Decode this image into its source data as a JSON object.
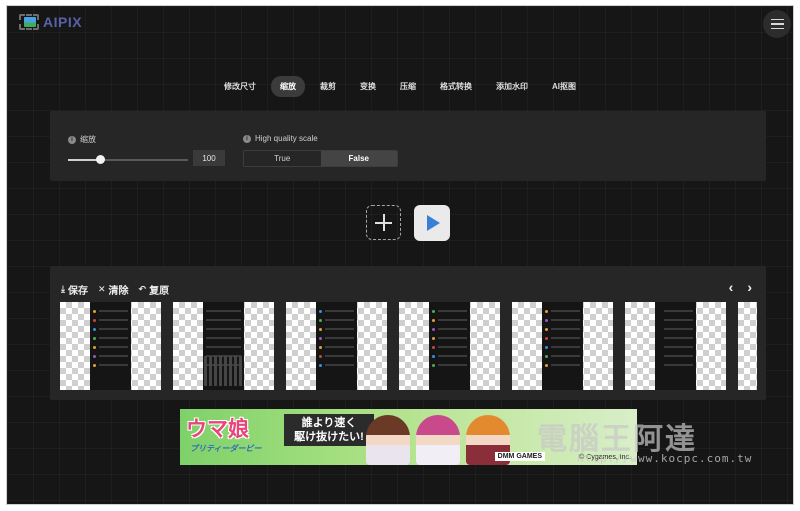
{
  "app": {
    "name": "AIPIX",
    "logo_icon": "image-icon",
    "menu_icon": "hamburger-icon"
  },
  "tabs": [
    {
      "label": "修改尺寸",
      "active": false
    },
    {
      "label": "缩放",
      "active": true
    },
    {
      "label": "裁剪",
      "active": false
    },
    {
      "label": "变换",
      "active": false
    },
    {
      "label": "压缩",
      "active": false
    },
    {
      "label": "格式转换",
      "active": false
    },
    {
      "label": "添加水印",
      "active": false
    },
    {
      "label": "AI抠图",
      "active": false
    }
  ],
  "settings": {
    "scale_label": "缩放",
    "scale_value": "100",
    "slider_fraction": 0.27,
    "hq_label": "High quality scale",
    "hq_options": [
      "True",
      "False"
    ],
    "hq_selected": "False"
  },
  "gallery": {
    "actions": [
      {
        "icon": "download-icon",
        "label": "保存"
      },
      {
        "icon": "close-icon",
        "label": "清除"
      },
      {
        "icon": "undo-icon",
        "label": "复原"
      }
    ],
    "prev_icon": "chevron-left-icon",
    "next_icon": "chevron-right-icon",
    "thumb_count": 7
  },
  "ad": {
    "title": "ウマ娘",
    "subtitle": "プリティーダービー",
    "slogan_line1": "誰より速く",
    "slogan_line2": "駆け抜けたい!",
    "brand": "DMM GAMES",
    "copyright": "© Cygames, Inc."
  },
  "watermark": {
    "text": "電腦王阿達",
    "url": "http://www.kocpc.com.tw"
  },
  "colors": {
    "background": "#161616",
    "panel": "#262626",
    "accent": "#3a7fd6",
    "logo": "#5961a8"
  }
}
